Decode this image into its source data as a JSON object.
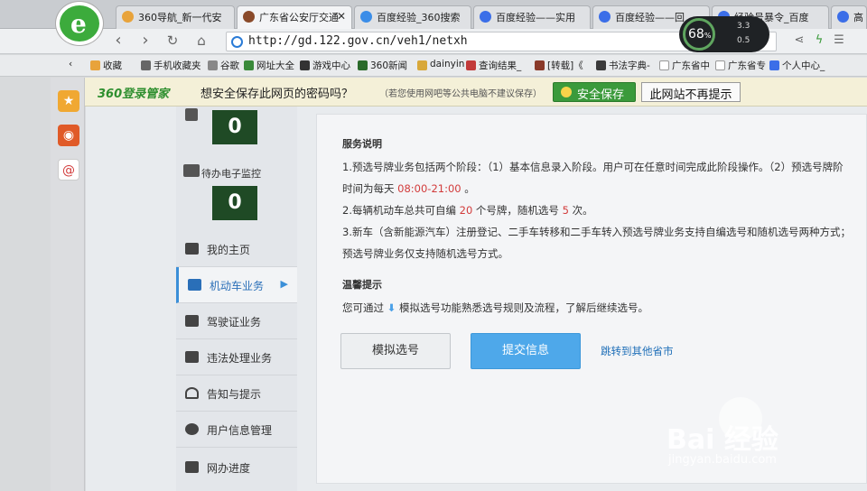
{
  "browser": {
    "logo": "e",
    "tabs": [
      {
        "label": "360导航_新一代安",
        "color": "#e8a33b"
      },
      {
        "label": "广东省公安厅交通",
        "color": "#8a4a2a"
      },
      {
        "label": "百度经验_360搜索",
        "color": "#3b8de8"
      },
      {
        "label": "百度经验——实用",
        "color": "#3b6ee8"
      },
      {
        "label": "百度经验——回",
        "color": "#3b6ee8"
      },
      {
        "label": "经验号暴令_百度",
        "color": "#3b6ee8"
      },
      {
        "label": "高",
        "color": "#3b6ee8"
      }
    ],
    "perf": {
      "percent": "68",
      "unit": "%",
      "up": "3.3",
      "down": "0.5"
    },
    "url": "http://gd.122.gov.cn/veh1/netxh",
    "bookmarks": [
      "收藏",
      "手机收藏夹",
      "谷歌",
      "网址大全",
      "游戏中心",
      "360新闻",
      "dainyin",
      "查询结果_",
      "[转载]《",
      "书法字典-",
      "广东省中",
      "广东省专",
      "个人中心_"
    ]
  },
  "password_bar": {
    "brand": "360登录管家",
    "message": "想安全保存此网页的密码吗？",
    "note": "（若您使用网吧等公共电脑不建议保存）",
    "save": "安全保存",
    "never": "此网站不再提示"
  },
  "sidebar": {
    "monitor_1_value": "0",
    "monitor_2_label": "待办电子监控",
    "monitor_2_value": "0",
    "menu": [
      {
        "label": "我的主页"
      },
      {
        "label": "机动车业务"
      },
      {
        "label": "驾驶证业务"
      },
      {
        "label": "违法处理业务"
      },
      {
        "label": "告知与提示"
      },
      {
        "label": "用户信息管理"
      },
      {
        "label": "网办进度"
      }
    ]
  },
  "content": {
    "service_title": "服务说明",
    "line1": "1.预选号牌业务包括两个阶段：（1）基本信息录入阶段。用户可在任意时间完成此阶段操作。（2）预选号牌阶",
    "line2_a": "时间为每天 ",
    "line2_time": "08:00-21:00",
    "line2_b": " 。",
    "line3_a": "2.每辆机动车总共可自编 ",
    "line3_n": "20",
    "line3_b": " 个号牌，随机选号 ",
    "line3_m": "5",
    "line3_c": " 次。",
    "line4": "3.新车（含新能源汽车）注册登记、二手车转移和二手车转入预选号牌业务支持自编选号和随机选号两种方式；",
    "line5": "预选号牌业务仅支持随机选号方式。",
    "tips_title": "温馨提示",
    "tips_a": "您可通过 ",
    "tips_arrow": "⬇",
    "tips_b": " 模拟选号功能熟悉选号规则及流程，了解后继续选号。",
    "btn_sim": "模拟选号",
    "btn_submit": "提交信息",
    "jump": "跳转到其他省市"
  },
  "watermark": {
    "big": "Bai 经验",
    "small": "jingyan.baidu.com"
  }
}
